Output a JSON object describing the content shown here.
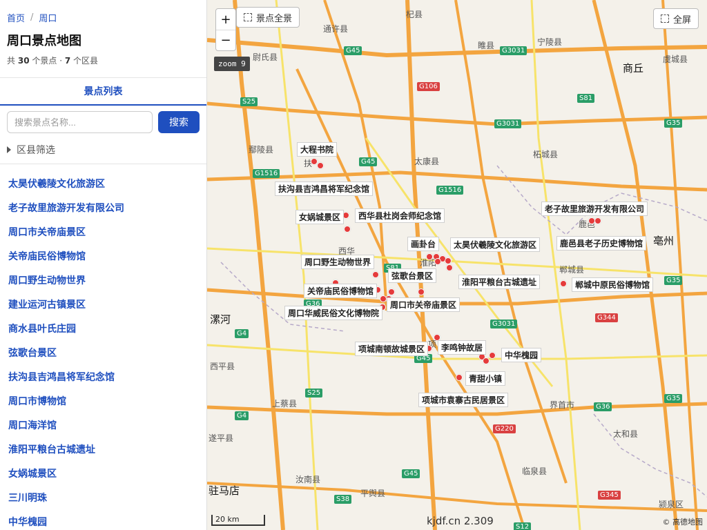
{
  "breadcrumb": {
    "home": "首页",
    "separator": "/",
    "current": "周口"
  },
  "page": {
    "title": "周口景点地图"
  },
  "summary": {
    "prefix": "共",
    "spots_count": "30",
    "spots_unit": "个景点 ·",
    "districts_count": "7",
    "districts_unit": "个区县"
  },
  "tabs": [
    {
      "label": "景点列表"
    }
  ],
  "search": {
    "placeholder": "搜索景点名称...",
    "button": "搜索"
  },
  "filter": {
    "label": "区县筛选"
  },
  "list": [
    "太昊伏羲陵文化旅游区",
    "老子故里旅游开发有限公司",
    "周口市关帝庙景区",
    "关帝庙民俗博物馆",
    "周口野生动物世界",
    "建业运河古镇景区",
    "商水县叶氏庄园",
    "弦歌台景区",
    "扶沟县吉鸿昌将军纪念馆",
    "周口市博物馆",
    "周口海洋馆",
    "淮阳平粮台古城遗址",
    "女娲城景区",
    "三川明珠",
    "中华槐园"
  ],
  "map": {
    "zoom_in": "+",
    "zoom_out": "−",
    "zoom_label": "zoom 9",
    "overview_button": "景点全景",
    "fullscreen_button": "全屏",
    "scale": "20 km",
    "brand": "kjdf.cn 2.309",
    "copyright": "© 高德地图",
    "poi_labels": [
      "大程书院",
      "扶沟县吉鸿昌将军纪念馆",
      "女娲城景区",
      "西华县杜岗会师纪念馆",
      "老子故里旅游开发有限公司",
      "画卦台",
      "太昊伏羲陵文化旅游区",
      "鹿邑县老子历史博物馆",
      "周口野生动物世界",
      "弦歌台景区",
      "淮阳平粮台古城遗址",
      "郸城中原民俗博物馆",
      "关帝庙民俗博物馆",
      "周口市关帝庙景区",
      "周口华威民俗文化博物院",
      "李鸣钟故居",
      "项城南顿故城景区",
      "中华槐园",
      "青甜小镇",
      "项城市袁寨古民居景区"
    ],
    "cities": [
      "商丘",
      "亳州",
      "漯河",
      "驻马店"
    ],
    "places": [
      "杞县",
      "通许县",
      "睢县",
      "宁陵县",
      "虞城县",
      "尉氏县",
      "鄢陵县",
      "太康县",
      "柘城县",
      "扶",
      "鹿邑",
      "西华",
      "淮阳",
      "郸城县",
      "项",
      "界首市",
      "西平县",
      "上蔡县",
      "遂平县",
      "汝南县",
      "平舆县",
      "临泉县",
      "太和县",
      "颍泉区"
    ],
    "roads": [
      "G45",
      "G3031",
      "G106",
      "S81",
      "G3031",
      "S25",
      "G45",
      "G1516",
      "G1516",
      "G35",
      "G35",
      "S81",
      "G36",
      "G3031",
      "G344",
      "G4",
      "S25",
      "G45",
      "G36",
      "G220",
      "G35",
      "G4",
      "G45",
      "S38",
      "G345",
      "S12"
    ]
  },
  "colors": {
    "accent": "#1f4fbf",
    "poi": "#e53b3b",
    "highway": "#f3a540"
  }
}
